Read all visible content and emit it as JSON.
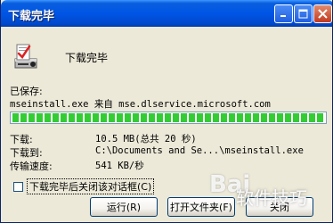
{
  "window": {
    "title": "下载完毕",
    "header_label": "下载完毕"
  },
  "details": {
    "saved_label": "已保存:",
    "source_line": "mseinstall.exe 来自 mse.dlservice.microsoft.com",
    "progress_percent": 100,
    "rows": [
      {
        "label": "下载:",
        "value": "10.5 MB(总共 20 秒)"
      },
      {
        "label": "下载到:",
        "value": "C:\\Documents and Se...\\mseinstall.exe"
      },
      {
        "label": "传输速度:",
        "value": "541 KB/秒"
      }
    ]
  },
  "options": {
    "close_on_complete_label": "下载完毕后关闭该对话框(C)",
    "close_on_complete_checked": false
  },
  "buttons": {
    "run": "运行(R)",
    "open_folder": "打开文件夹(F)",
    "close": "关闭"
  },
  "watermark": {
    "brand": "Bai",
    "text": "软件技巧"
  },
  "colors": {
    "titlebar": "#0055e5",
    "dialog_bg": "#ece9d8",
    "progress_green": "#33cc33"
  }
}
